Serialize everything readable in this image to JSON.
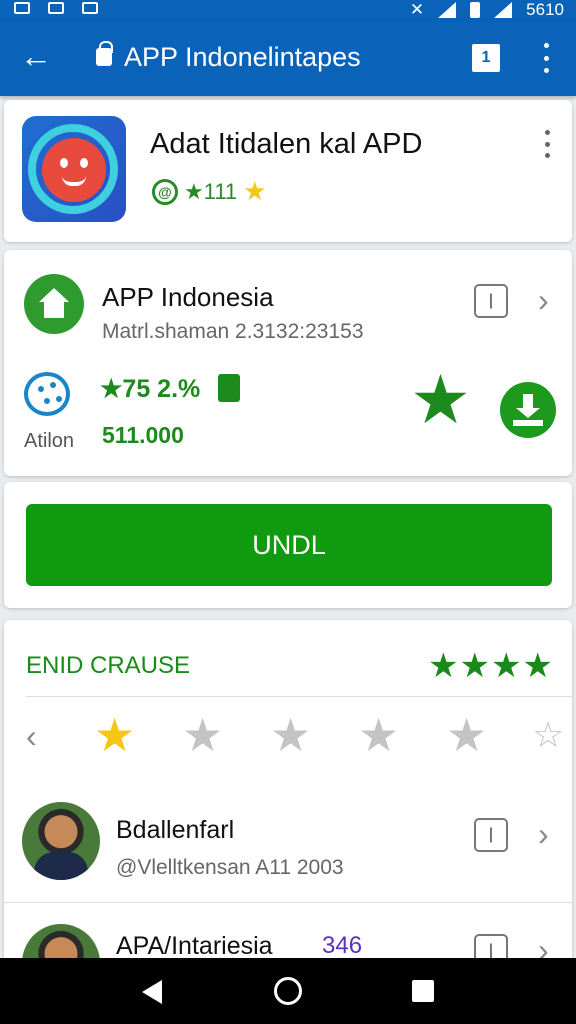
{
  "status": {
    "time": "5610"
  },
  "appbar": {
    "title": "APP Indonelintapes",
    "tabs_count": "1"
  },
  "app": {
    "name": "Adat Itidalen kal   APD",
    "rating": "★111",
    "rating_icon_text": "@"
  },
  "package": {
    "name": "APP Indonesia",
    "version": "Matrl.shaman 2.3132:23153",
    "action_label": "Atilon",
    "percent": "★75 2.%",
    "count": "511.000",
    "info_badge": "|"
  },
  "install": {
    "button_label": "UNDL"
  },
  "reviews_section": {
    "title": "ENID CRAUSE",
    "summary_stars": "★★★★",
    "rating_filter": [
      "★",
      "★",
      "★",
      "★",
      "★",
      "☆"
    ],
    "selected_star_index": 0
  },
  "reviews": [
    {
      "name": "Bdallenfarl",
      "handle": "@Vlelltkensan A11 2003",
      "badge": "|",
      "number": ""
    },
    {
      "name": "APA/Intariesia",
      "handle": "",
      "badge": "|",
      "number": "346"
    }
  ],
  "colors": {
    "primary": "#0a63b8",
    "accent_green": "#109a10",
    "star_gold": "#f5c518"
  }
}
